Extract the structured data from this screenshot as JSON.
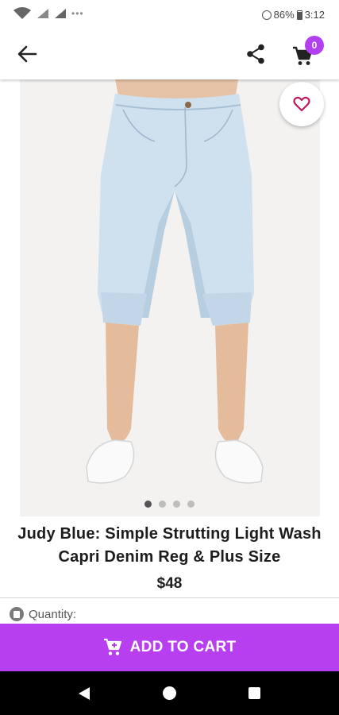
{
  "status_bar": {
    "battery": "86%",
    "time": "3:12"
  },
  "app_bar": {
    "cart_count": "0"
  },
  "product": {
    "title": "Judy Blue: Simple Strutting Light Wash Capri Denim Reg & Plus Size",
    "price": "$48",
    "image_count": 4,
    "active_image": 1
  },
  "quantity": {
    "label": "Quantity:"
  },
  "actions": {
    "add_to_cart_label": "ADD TO CART"
  },
  "colors": {
    "accent": "#b73ff0",
    "badge": "#b340f0",
    "wishlist_heart": "#c2185b"
  },
  "icons": [
    "wifi-icon",
    "signal-icon",
    "alarm-icon",
    "battery-icon",
    "back-arrow-icon",
    "share-icon",
    "cart-icon",
    "heart-outline-icon",
    "cart-add-icon",
    "nav-back-icon",
    "nav-home-icon",
    "nav-recent-icon"
  ]
}
